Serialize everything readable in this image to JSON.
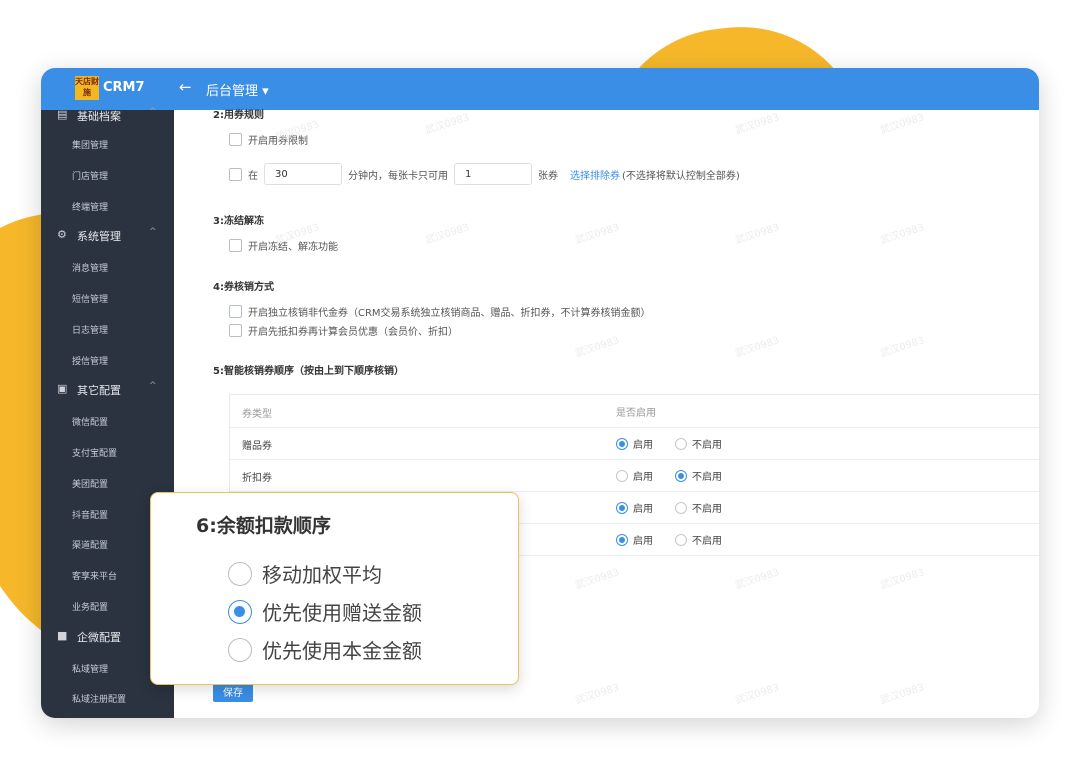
{
  "brand": {
    "logo_text": "天店财施",
    "name": "CRM7"
  },
  "header": {
    "back_icon": "arrow-left-icon",
    "menu_title": "后台管理 ▾"
  },
  "sidebar": {
    "top_partial": "基础档案",
    "items": [
      {
        "label": "集团管理",
        "type": "item"
      },
      {
        "label": "门店管理",
        "type": "item"
      },
      {
        "label": "终端管理",
        "type": "item"
      },
      {
        "label": "系统管理",
        "type": "group",
        "icon": "gear-icon"
      },
      {
        "label": "消息管理",
        "type": "item"
      },
      {
        "label": "短信管理",
        "type": "item"
      },
      {
        "label": "日志管理",
        "type": "item"
      },
      {
        "label": "授信管理",
        "type": "item"
      },
      {
        "label": "其它配置",
        "type": "group",
        "icon": "monitor-icon"
      },
      {
        "label": "微信配置",
        "type": "item"
      },
      {
        "label": "支付宝配置",
        "type": "item"
      },
      {
        "label": "美团配置",
        "type": "item"
      },
      {
        "label": "抖音配置",
        "type": "item"
      },
      {
        "label": "渠道配置",
        "type": "item"
      },
      {
        "label": "客享来平台",
        "type": "item"
      },
      {
        "label": "业务配置",
        "type": "item"
      },
      {
        "label": "企微配置",
        "type": "group",
        "icon": "folder-icon"
      },
      {
        "label": "私域管理",
        "type": "item"
      },
      {
        "label": "私域注册配置",
        "type": "item"
      }
    ]
  },
  "rules": {
    "s2_title": "2:用券规则",
    "s2_limit": "开启用券限制",
    "s2_in": "在",
    "s2_minutes": "30",
    "s2_mid": "分钟内，每张卡只可用",
    "s2_count": "1",
    "s2_unit": "张券",
    "s2_link": "选择排除券",
    "s2_note": "(不选择将默认控制全部券)",
    "s3_title": "3:冻结解冻",
    "s3_opt": "开启冻结、解冻功能",
    "s4_title": "4:券核销方式",
    "s4_opt1": "开启独立核销非代金券（CRM交易系统独立核销商品、赠品、折扣券，不计算券核销金额）",
    "s4_opt2": "开启先抵扣券再计算会员优惠（会员价、折扣）",
    "s5_title": "5:智能核销券顺序（按由上到下顺序核销）"
  },
  "table": {
    "col1": "券类型",
    "col2": "是否启用",
    "enable": "启用",
    "disable": "不启用",
    "rows": [
      {
        "name": "赠品券",
        "enabled": true
      },
      {
        "name": "折扣券",
        "enabled": false
      },
      {
        "name": "",
        "enabled": true
      },
      {
        "name": "",
        "enabled": true
      }
    ]
  },
  "popup": {
    "title": "6:余额扣款顺序",
    "options": [
      {
        "label": "移动加权平均",
        "selected": false
      },
      {
        "label": "优先使用赠送金额",
        "selected": true
      },
      {
        "label": "优先使用本金金额",
        "selected": false
      }
    ]
  },
  "save_label": "保存",
  "watermark": "武汉0983",
  "colors": {
    "primary": "#3a8ee6",
    "sidebar": "#2b3240",
    "accent": "#f6b82a"
  }
}
